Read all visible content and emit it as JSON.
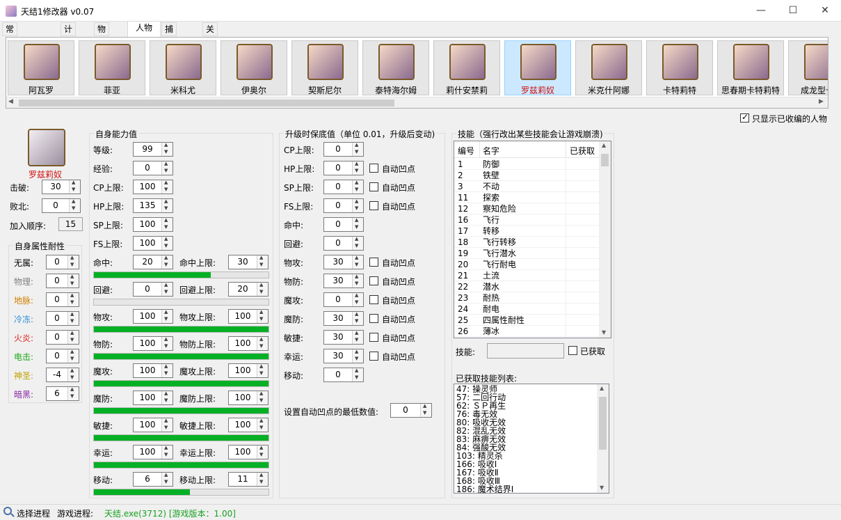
{
  "window": {
    "title": "天结1修改器 v0.07",
    "minimize": "—",
    "maximize": "☐",
    "close": "✕"
  },
  "tabs": [
    "常用数据修改",
    "计算器",
    "物品",
    "人物",
    "捕获怪物",
    "关于"
  ],
  "characters": [
    "阿瓦罗",
    "菲亚",
    "米科尤",
    "伊奥尔",
    "契斯尼尔",
    "泰特海尔姆",
    "莉什安禁莉",
    "罗兹莉奴",
    "米克什阿娜",
    "卡特莉特",
    "思春期卡特莉特",
    "成龙型卡特"
  ],
  "only_enlisted": {
    "label": "只显示已收编的人物",
    "checked": true
  },
  "profile": {
    "name": "罗兹莉奴",
    "defeat_label": "击破:",
    "defeat": "30",
    "lose_label": "败北:",
    "lose": "0",
    "join_label": "加入顺序:",
    "join": "15"
  },
  "resist": {
    "title": "自身属性耐性",
    "items": [
      {
        "label": "无属:",
        "value": "0",
        "color": "#000000"
      },
      {
        "label": "物理:",
        "value": "0",
        "color": "#808080"
      },
      {
        "label": "地脉:",
        "value": "0",
        "color": "#d08000"
      },
      {
        "label": "冷冻:",
        "value": "0",
        "color": "#2a8fd6"
      },
      {
        "label": "火炎:",
        "value": "0",
        "color": "#e02020"
      },
      {
        "label": "电击:",
        "value": "0",
        "color": "#18a818"
      },
      {
        "label": "神圣:",
        "value": "-4",
        "color": "#c0a000"
      },
      {
        "label": "暗黑:",
        "value": "6",
        "color": "#8a2aa8"
      }
    ]
  },
  "stats": {
    "title": "自身能力值",
    "basic": [
      {
        "label": "等级:",
        "value": "99"
      },
      {
        "label": "经验:",
        "value": "0"
      },
      {
        "label": "CP上限:",
        "value": "100"
      },
      {
        "label": "HP上限:",
        "value": "135"
      },
      {
        "label": "SP上限:",
        "value": "100"
      },
      {
        "label": "FS上限:",
        "value": "100"
      }
    ],
    "pairs": [
      {
        "label": "命中:",
        "value": "20",
        "max_label": "命中上限:",
        "max": "30",
        "progress": 0.67
      },
      {
        "label": "回避:",
        "value": "0",
        "max_label": "回避上限:",
        "max": "20",
        "progress": 0
      },
      {
        "label": "物攻:",
        "value": "100",
        "max_label": "物攻上限:",
        "max": "100",
        "progress": 1
      },
      {
        "label": "物防:",
        "value": "100",
        "max_label": "物防上限:",
        "max": "100",
        "progress": 1
      },
      {
        "label": "魔攻:",
        "value": "100",
        "max_label": "魔攻上限:",
        "max": "100",
        "progress": 1
      },
      {
        "label": "魔防:",
        "value": "100",
        "max_label": "魔防上限:",
        "max": "100",
        "progress": 1
      },
      {
        "label": "敏捷:",
        "value": "100",
        "max_label": "敏捷上限:",
        "max": "100",
        "progress": 1
      },
      {
        "label": "幸运:",
        "value": "100",
        "max_label": "幸运上限:",
        "max": "100",
        "progress": 1
      },
      {
        "label": "移动:",
        "value": "6",
        "max_label": "移动上限:",
        "max": "11",
        "progress": 0.55
      }
    ]
  },
  "levelup": {
    "title": "升级时保底值（单位 0.01，升级后变动)",
    "auto_label": "自动凹点",
    "items": [
      {
        "label": "CP上限:",
        "value": "0",
        "auto": false
      },
      {
        "label": "HP上限:",
        "value": "0",
        "auto": true
      },
      {
        "label": "SP上限:",
        "value": "0",
        "auto": true
      },
      {
        "label": "FS上限:",
        "value": "0",
        "auto": true
      },
      {
        "label": "命中:",
        "value": "0",
        "auto": false
      },
      {
        "label": "回避:",
        "value": "0",
        "auto": false
      },
      {
        "label": "物攻:",
        "value": "30",
        "auto": true
      },
      {
        "label": "物防:",
        "value": "30",
        "auto": true
      },
      {
        "label": "魔攻:",
        "value": "0",
        "auto": true
      },
      {
        "label": "魔防:",
        "value": "30",
        "auto": true
      },
      {
        "label": "敏捷:",
        "value": "30",
        "auto": true
      },
      {
        "label": "幸运:",
        "value": "30",
        "auto": true
      },
      {
        "label": "移动:",
        "value": "0",
        "auto": false
      }
    ],
    "min_label": "设置自动凹点的最低数值:",
    "min_value": "0"
  },
  "skills": {
    "title": "技能（强行改出某些技能会让游戏崩溃)",
    "headers": [
      "编号",
      "名字",
      "已获取"
    ],
    "rows": [
      [
        "1",
        "防御"
      ],
      [
        "2",
        "铁壁"
      ],
      [
        "3",
        "不动"
      ],
      [
        "11",
        "探索"
      ],
      [
        "12",
        "察知危险"
      ],
      [
        "16",
        "飞行"
      ],
      [
        "17",
        "转移"
      ],
      [
        "18",
        "飞行转移"
      ],
      [
        "19",
        "飞行潜水"
      ],
      [
        "20",
        "飞行耐电"
      ],
      [
        "21",
        "土流"
      ],
      [
        "22",
        "潜水"
      ],
      [
        "23",
        "耐热"
      ],
      [
        "24",
        "耐电"
      ],
      [
        "25",
        "四属性耐性"
      ],
      [
        "26",
        "薄冰"
      ]
    ],
    "skill_label": "技能:",
    "acquired_label": "已获取",
    "acquired_list_title": "已获取技能列表:",
    "acquired_list": [
      "47: 操灵师",
      "57: 二回行动",
      "62: ＳＰ再生",
      "76: 毒无效",
      "80: 吸收无效",
      "82: 混乱无效",
      "83: 麻痹无效",
      "84: 强酸无效",
      "103: 精灵杀",
      "166: 吸收Ⅰ",
      "167: 吸收Ⅱ",
      "168: 吸收Ⅲ",
      "186: 魔术结界Ⅰ"
    ]
  },
  "status": {
    "select_label": "选择进程",
    "process_label": "游戏进程:",
    "process_value": "天结.exe(3712) [游戏版本：1.00]"
  }
}
